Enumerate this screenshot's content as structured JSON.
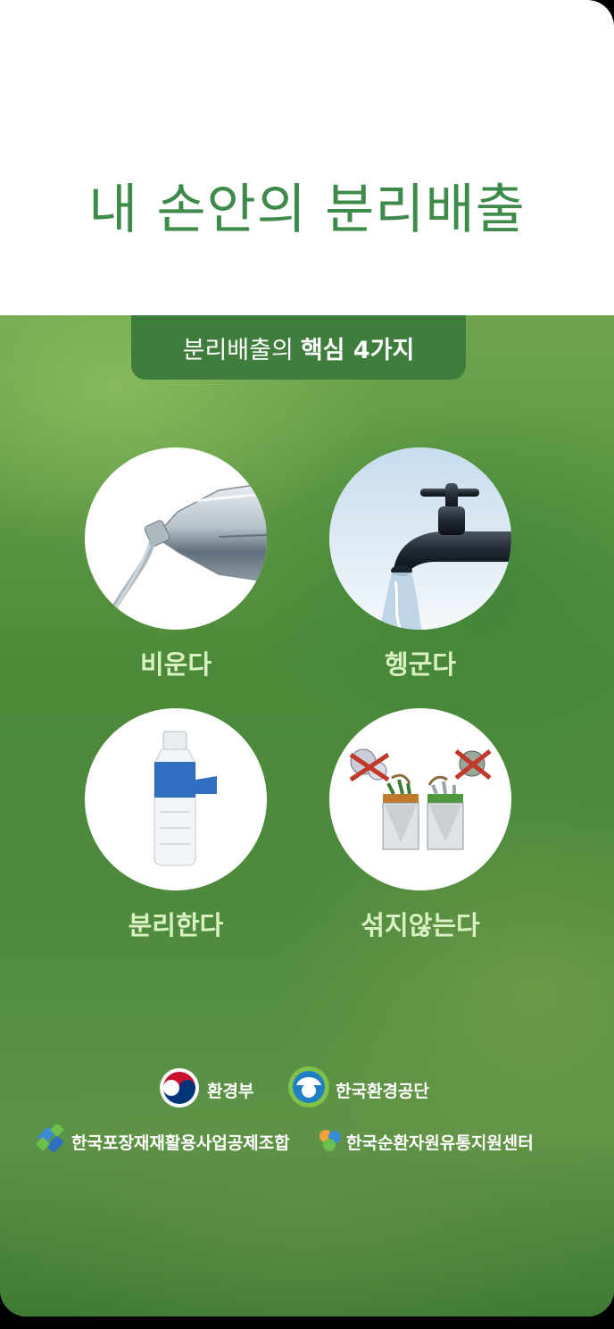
{
  "title": "내 손안의 분리배출",
  "banner": {
    "prefix": "분리배출의",
    "highlight": "핵심 4가지"
  },
  "steps": [
    {
      "label": "비운다",
      "icon": "pouring-bottle-icon"
    },
    {
      "label": "헹군다",
      "icon": "water-faucet-icon"
    },
    {
      "label": "분리한다",
      "icon": "bottle-label-icon"
    },
    {
      "label": "섞지않는다",
      "icon": "sorting-bins-icon"
    }
  ],
  "orgs": {
    "ministry": "환경부",
    "keco": "한국환경공단",
    "kpa": "한국포장재재활용사업공제조합",
    "krc": "한국순환자원유통지원센터"
  },
  "colors": {
    "title": "#3e8a4a",
    "pill": "#3f7d3c",
    "label": "#d8f0c2"
  }
}
